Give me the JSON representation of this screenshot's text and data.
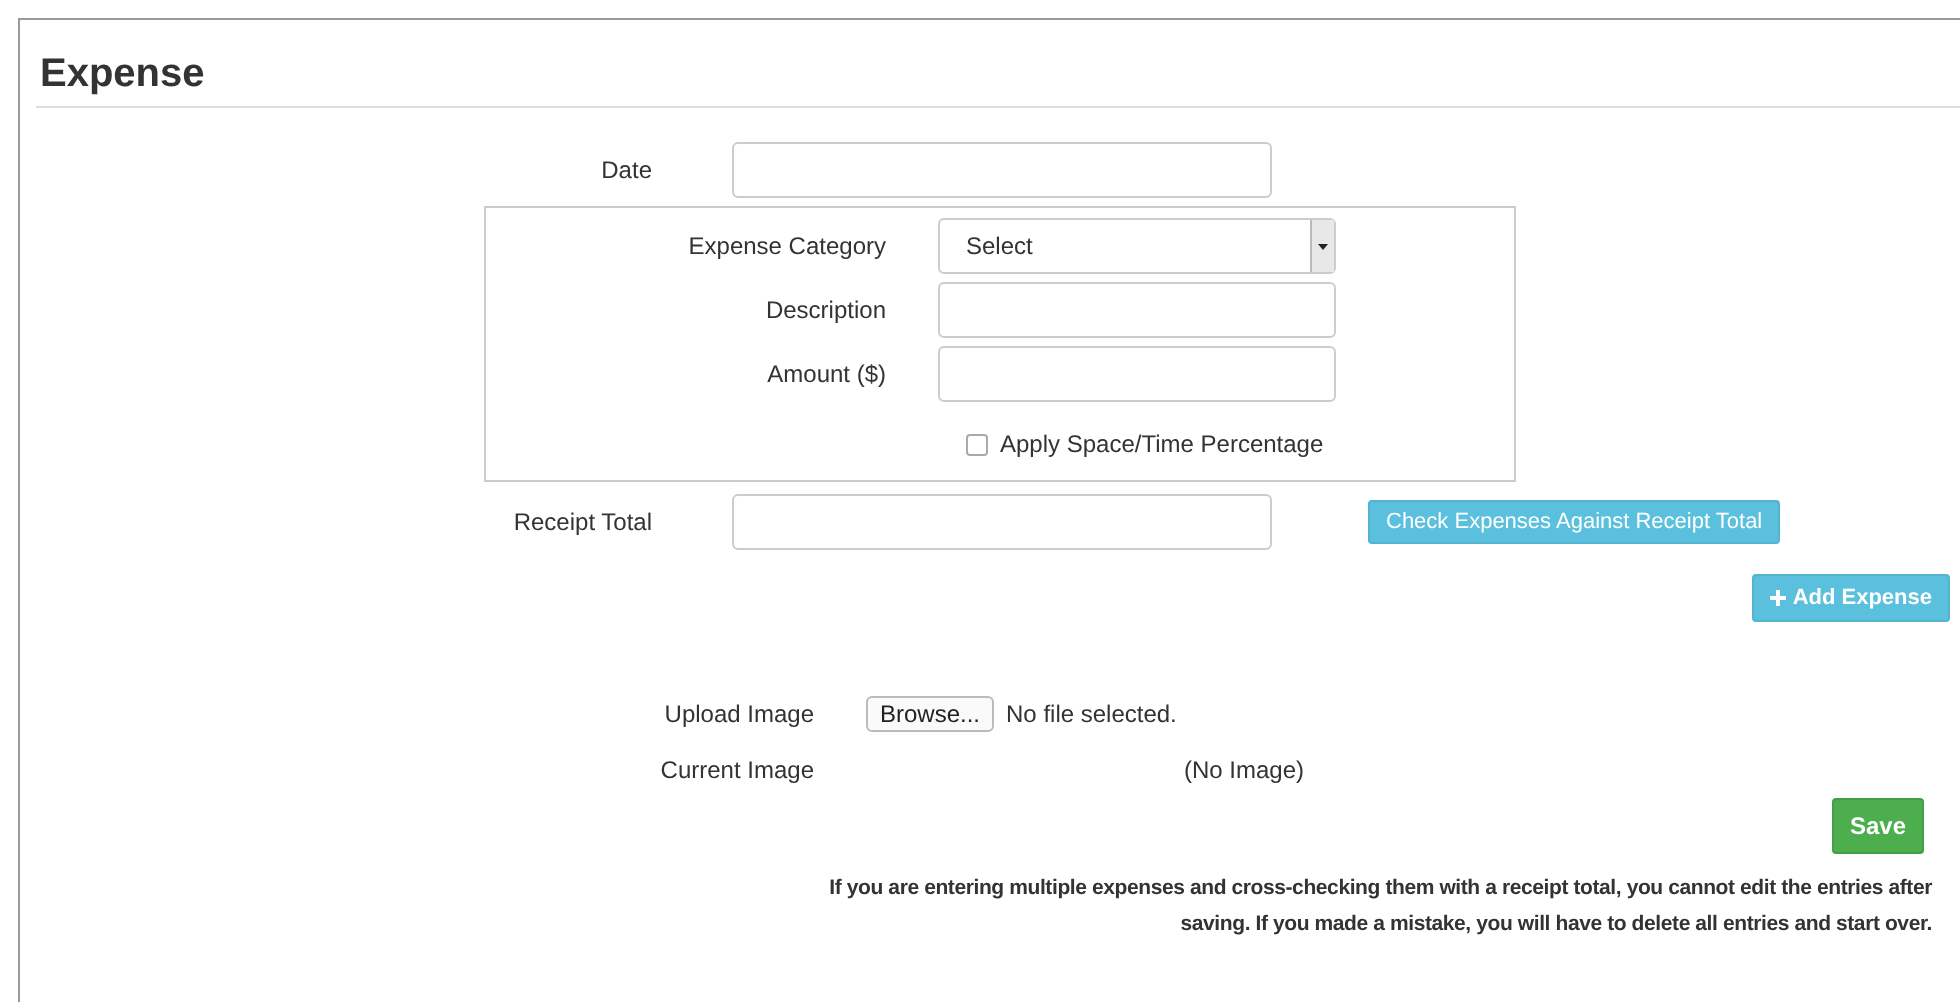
{
  "title": "Expense",
  "date": {
    "label": "Date"
  },
  "category_box": {
    "category": {
      "label": "Expense Category",
      "value": "Select"
    },
    "description": {
      "label": "Description"
    },
    "amount": {
      "label": "Amount ($)"
    },
    "apply_percentage": {
      "label": "Apply Space/Time Percentage",
      "checked": false
    }
  },
  "receipt_total": {
    "label": "Receipt Total",
    "button": "Check Expenses Against Receipt Total"
  },
  "add_expense_button": "Add Expense",
  "upload_image": {
    "label": "Upload Image",
    "button": "Browse...",
    "status": "No file selected."
  },
  "current_image": {
    "label": "Current Image",
    "value": "(No Image)"
  },
  "save_button": "Save",
  "note": "If you are entering multiple expenses and cross-checking them with a receipt total, you cannot edit the entries after saving. If you made a mistake, you will have to delete all entries and start over."
}
